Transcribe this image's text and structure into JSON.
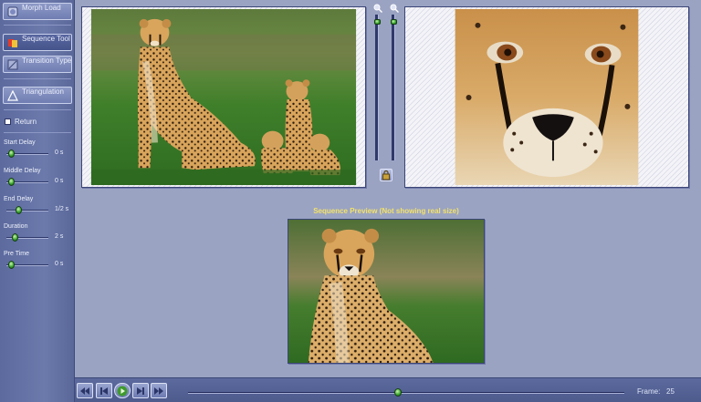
{
  "sidebar": {
    "buttons": [
      {
        "label": "Morph Load"
      },
      {
        "label": "Sequence Tool"
      },
      {
        "label": "Transition Types"
      },
      {
        "label": "Triangulation"
      }
    ],
    "checkbox_label": "Return",
    "sliders": [
      {
        "label": "Start Delay",
        "value": "0 s",
        "level": 0.05
      },
      {
        "label": "Middle Delay",
        "value": "0 s",
        "level": 0.05
      },
      {
        "label": "End Delay",
        "value": "1/2 s",
        "level": 0.25
      },
      {
        "label": "Duration",
        "value": "2 s",
        "level": 0.15
      },
      {
        "label": "Pre Time",
        "value": "0 s",
        "level": 0.05
      }
    ]
  },
  "preview": {
    "caption": "Sequence Preview (Not showing real size)"
  },
  "zoom": {
    "left_level": 0.0,
    "right_level": 0.0
  },
  "bottombar": {
    "frame_label": "Frame:",
    "frame_value": "25",
    "timeline_position": 0.49
  },
  "colors": {
    "background": "#9aa3c2",
    "sidebar": "#5c6a9e",
    "accent_green": "#37a32b",
    "caption": "#f2e26a"
  },
  "icons": [
    "morph-load-icon",
    "sequence-tool-icon",
    "transition-types-icon",
    "triangulation-icon",
    "zoom-in-icon",
    "zoom-out-icon",
    "lock-icon",
    "rewind-icon",
    "step-back-icon",
    "play-icon",
    "step-forward-icon",
    "fast-forward-icon"
  ]
}
